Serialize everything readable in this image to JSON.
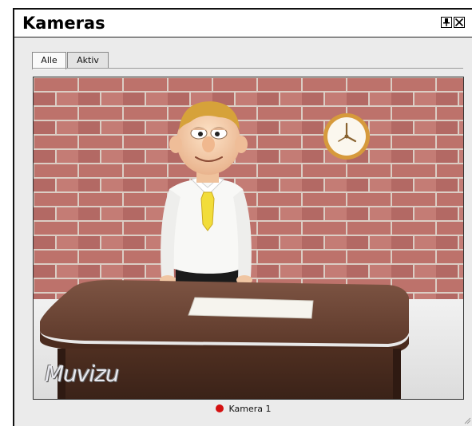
{
  "window": {
    "title": "Kameras",
    "buttons": [
      "pin-icon",
      "close-icon"
    ]
  },
  "tabs": [
    {
      "label": "Alle",
      "active": true
    },
    {
      "label": "Aktiv",
      "active": false
    }
  ],
  "camera_view": {
    "watermark": "Muvizu"
  },
  "status": {
    "camera_label": "Kamera 1",
    "indicator_color": "#d41010"
  },
  "colors": {
    "background": "#ebebeb",
    "wall_brick": "#b5645f",
    "desk": "#6a4232"
  }
}
